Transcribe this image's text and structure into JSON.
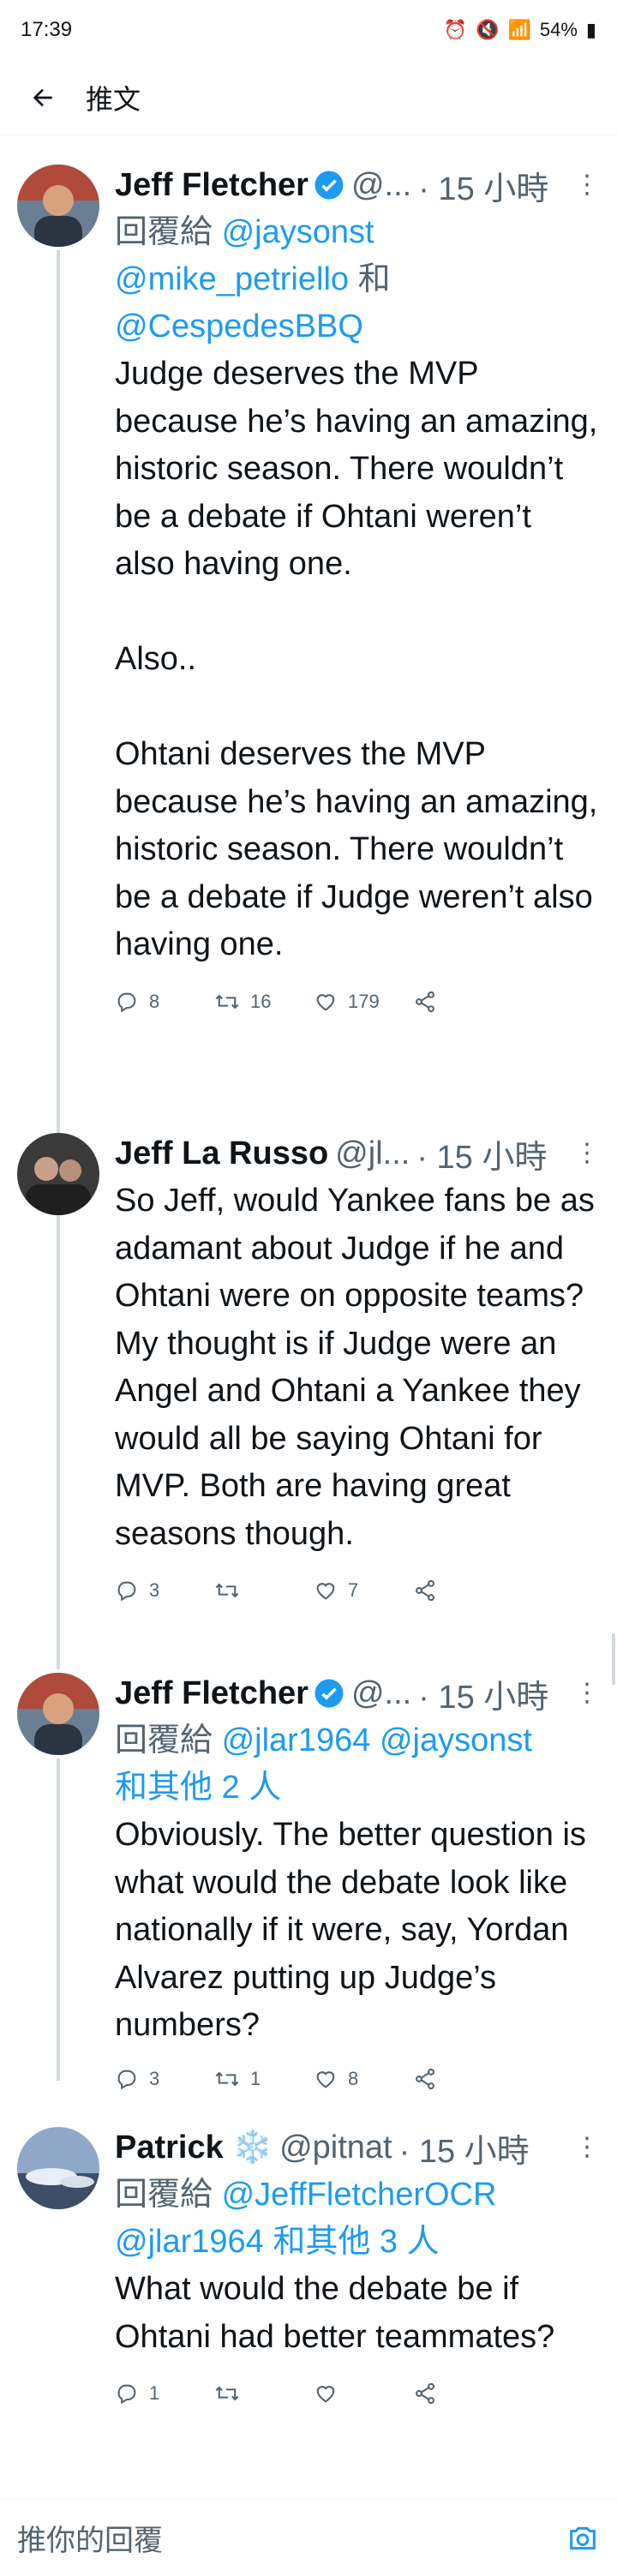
{
  "status": {
    "time": "17:39",
    "battery": "54%"
  },
  "appbar": {
    "title": "推文"
  },
  "tweets": [
    {
      "name": "Jeff Fletcher",
      "verified": true,
      "handle": "@...",
      "time": "· 15 小時",
      "reply_prefix": "回覆給",
      "reply_links": [
        "@jaysonst",
        "@mike_petriello"
      ],
      "reply_and": "和",
      "reply_link_last": "@CespedesBBQ",
      "body": "Judge deserves the MVP because he’s having an amazing, historic season. There wouldn’t be a debate if Ohtani weren’t also having one.\n\nAlso..\n\nOhtani deserves the MVP because he’s having an amazing, historic season. There wouldn’t be a debate if Judge weren’t also having one.",
      "stats": {
        "replies": "8",
        "retweets": "16",
        "likes": "179"
      }
    },
    {
      "name": "Jeff La Russo",
      "verified": false,
      "handle": "@jl...",
      "time": "· 15 小時",
      "body": "So Jeff, would Yankee fans be as adamant about Judge if he and Ohtani were on opposite teams? My thought is if Judge were an Angel and Ohtani a Yankee they would all be saying Ohtani for MVP. Both are having great seasons though.",
      "stats": {
        "replies": "3",
        "retweets": "",
        "likes": "7"
      }
    },
    {
      "name": "Jeff Fletcher",
      "verified": true,
      "handle": "@...",
      "time": "· 15 小時",
      "reply_prefix": "回覆給",
      "reply_links": [
        "@jlar1964",
        "@jaysonst"
      ],
      "reply_others": "和其他 2 人",
      "body": "Obviously. The better question is what would the debate look like nationally if it were, say, Yordan Alvarez putting up Judge’s numbers?",
      "stats": {
        "replies": "3",
        "retweets": "1",
        "likes": "8"
      }
    },
    {
      "name": "Patrick",
      "verified": false,
      "emoji": "❄️",
      "handle": "@pitnat",
      "time": "· 15 小時",
      "reply_prefix": "回覆給",
      "reply_links": [
        "@JeffFletcherOCR",
        "@jlar1964"
      ],
      "reply_others": "和其他 3 人",
      "body": "What would the debate be if Ohtani had better teammates?",
      "stats": {
        "replies": "1",
        "retweets": "",
        "likes": ""
      }
    }
  ],
  "composer": {
    "placeholder": "推你的回覆"
  },
  "colors": {
    "accent": "#1d9bf0",
    "muted": "#536471",
    "text": "#0f1419"
  },
  "icons": [
    "back-arrow-icon",
    "verified-badge-icon",
    "more-icon",
    "reply-icon",
    "retweet-icon",
    "like-icon",
    "share-icon",
    "camera-icon"
  ]
}
